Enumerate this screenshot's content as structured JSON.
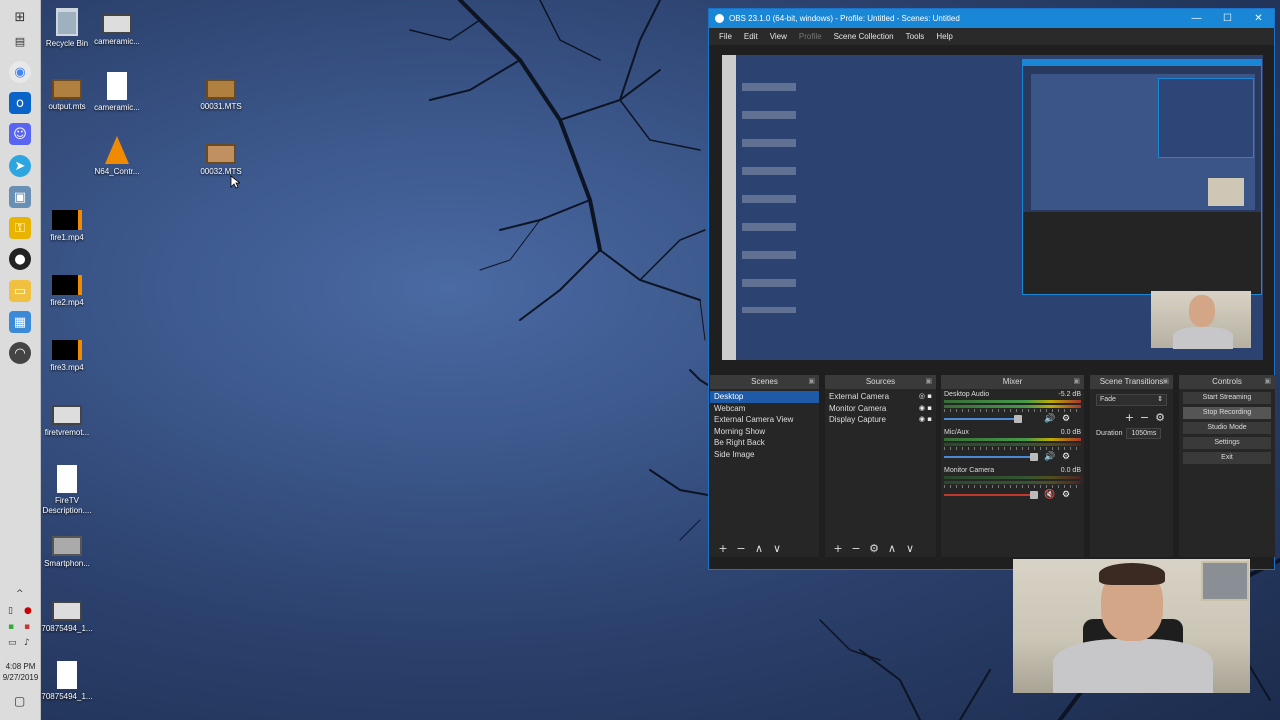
{
  "taskbar": {
    "clock_time": "4:08 PM",
    "clock_date": "9/27/2019",
    "chevron": "^"
  },
  "desktop_icons": [
    {
      "label": "Recycle Bin",
      "icon": "recycle-bin-icon"
    },
    {
      "label": "cameramic...",
      "icon": "video-file-icon"
    },
    {
      "label": "output.mts",
      "icon": "video-file-icon"
    },
    {
      "label": "cameramic...",
      "icon": "blank-file-icon"
    },
    {
      "label": "00031.MTS",
      "icon": "video-file-icon"
    },
    {
      "label": "N64_Contr...",
      "icon": "vlc-icon"
    },
    {
      "label": "00032.MTS",
      "icon": "video-file-icon"
    },
    {
      "label": "fire1.mp4",
      "icon": "video-file-icon"
    },
    {
      "label": "fire2.mp4",
      "icon": "video-file-icon"
    },
    {
      "label": "fire3.mp4",
      "icon": "video-file-icon"
    },
    {
      "label": "firetvremot...",
      "icon": "image-file-icon"
    },
    {
      "label": "FireTV Description....",
      "icon": "blank-file-icon"
    },
    {
      "label": "Smartphon...",
      "icon": "image-file-icon"
    },
    {
      "label": "70875494_1...",
      "icon": "image-file-icon"
    },
    {
      "label": "70875494_1...",
      "icon": "blank-file-icon"
    }
  ],
  "obs": {
    "title": "OBS 23.1.0 (64-bit, windows) - Profile: Untitled - Scenes: Untitled",
    "menu": [
      "File",
      "Edit",
      "View",
      "Profile",
      "Scene Collection",
      "Tools",
      "Help"
    ],
    "panels": {
      "scenes_title": "Scenes",
      "sources_title": "Sources",
      "mixer_title": "Mixer",
      "transitions_title": "Scene Transitions",
      "controls_title": "Controls"
    },
    "scenes": [
      "Desktop",
      "Webcam",
      "External Camera View",
      "Morning Show",
      "Be Right Back",
      "Side Image"
    ],
    "sources": [
      "External Camera",
      "Monitor Camera",
      "Display Capture"
    ],
    "mixer": [
      {
        "name": "Desktop Audio",
        "db": "-5.2 dB",
        "level": 0.75,
        "muted": false
      },
      {
        "name": "Mic/Aux",
        "db": "0.0 dB",
        "level": 0.55,
        "muted": false
      },
      {
        "name": "Monitor Camera",
        "db": "0.0 dB",
        "level": 0.0,
        "muted": true
      }
    ],
    "transitions": {
      "selected": "Fade",
      "duration_label": "Duration",
      "duration_value": "1050ms"
    },
    "controls": [
      "Start Streaming",
      "Stop Recording",
      "Studio Mode",
      "Settings",
      "Exit"
    ]
  },
  "colors": {
    "obs_titlebar": "#1a86d6",
    "selection": "#1e5aa8"
  }
}
